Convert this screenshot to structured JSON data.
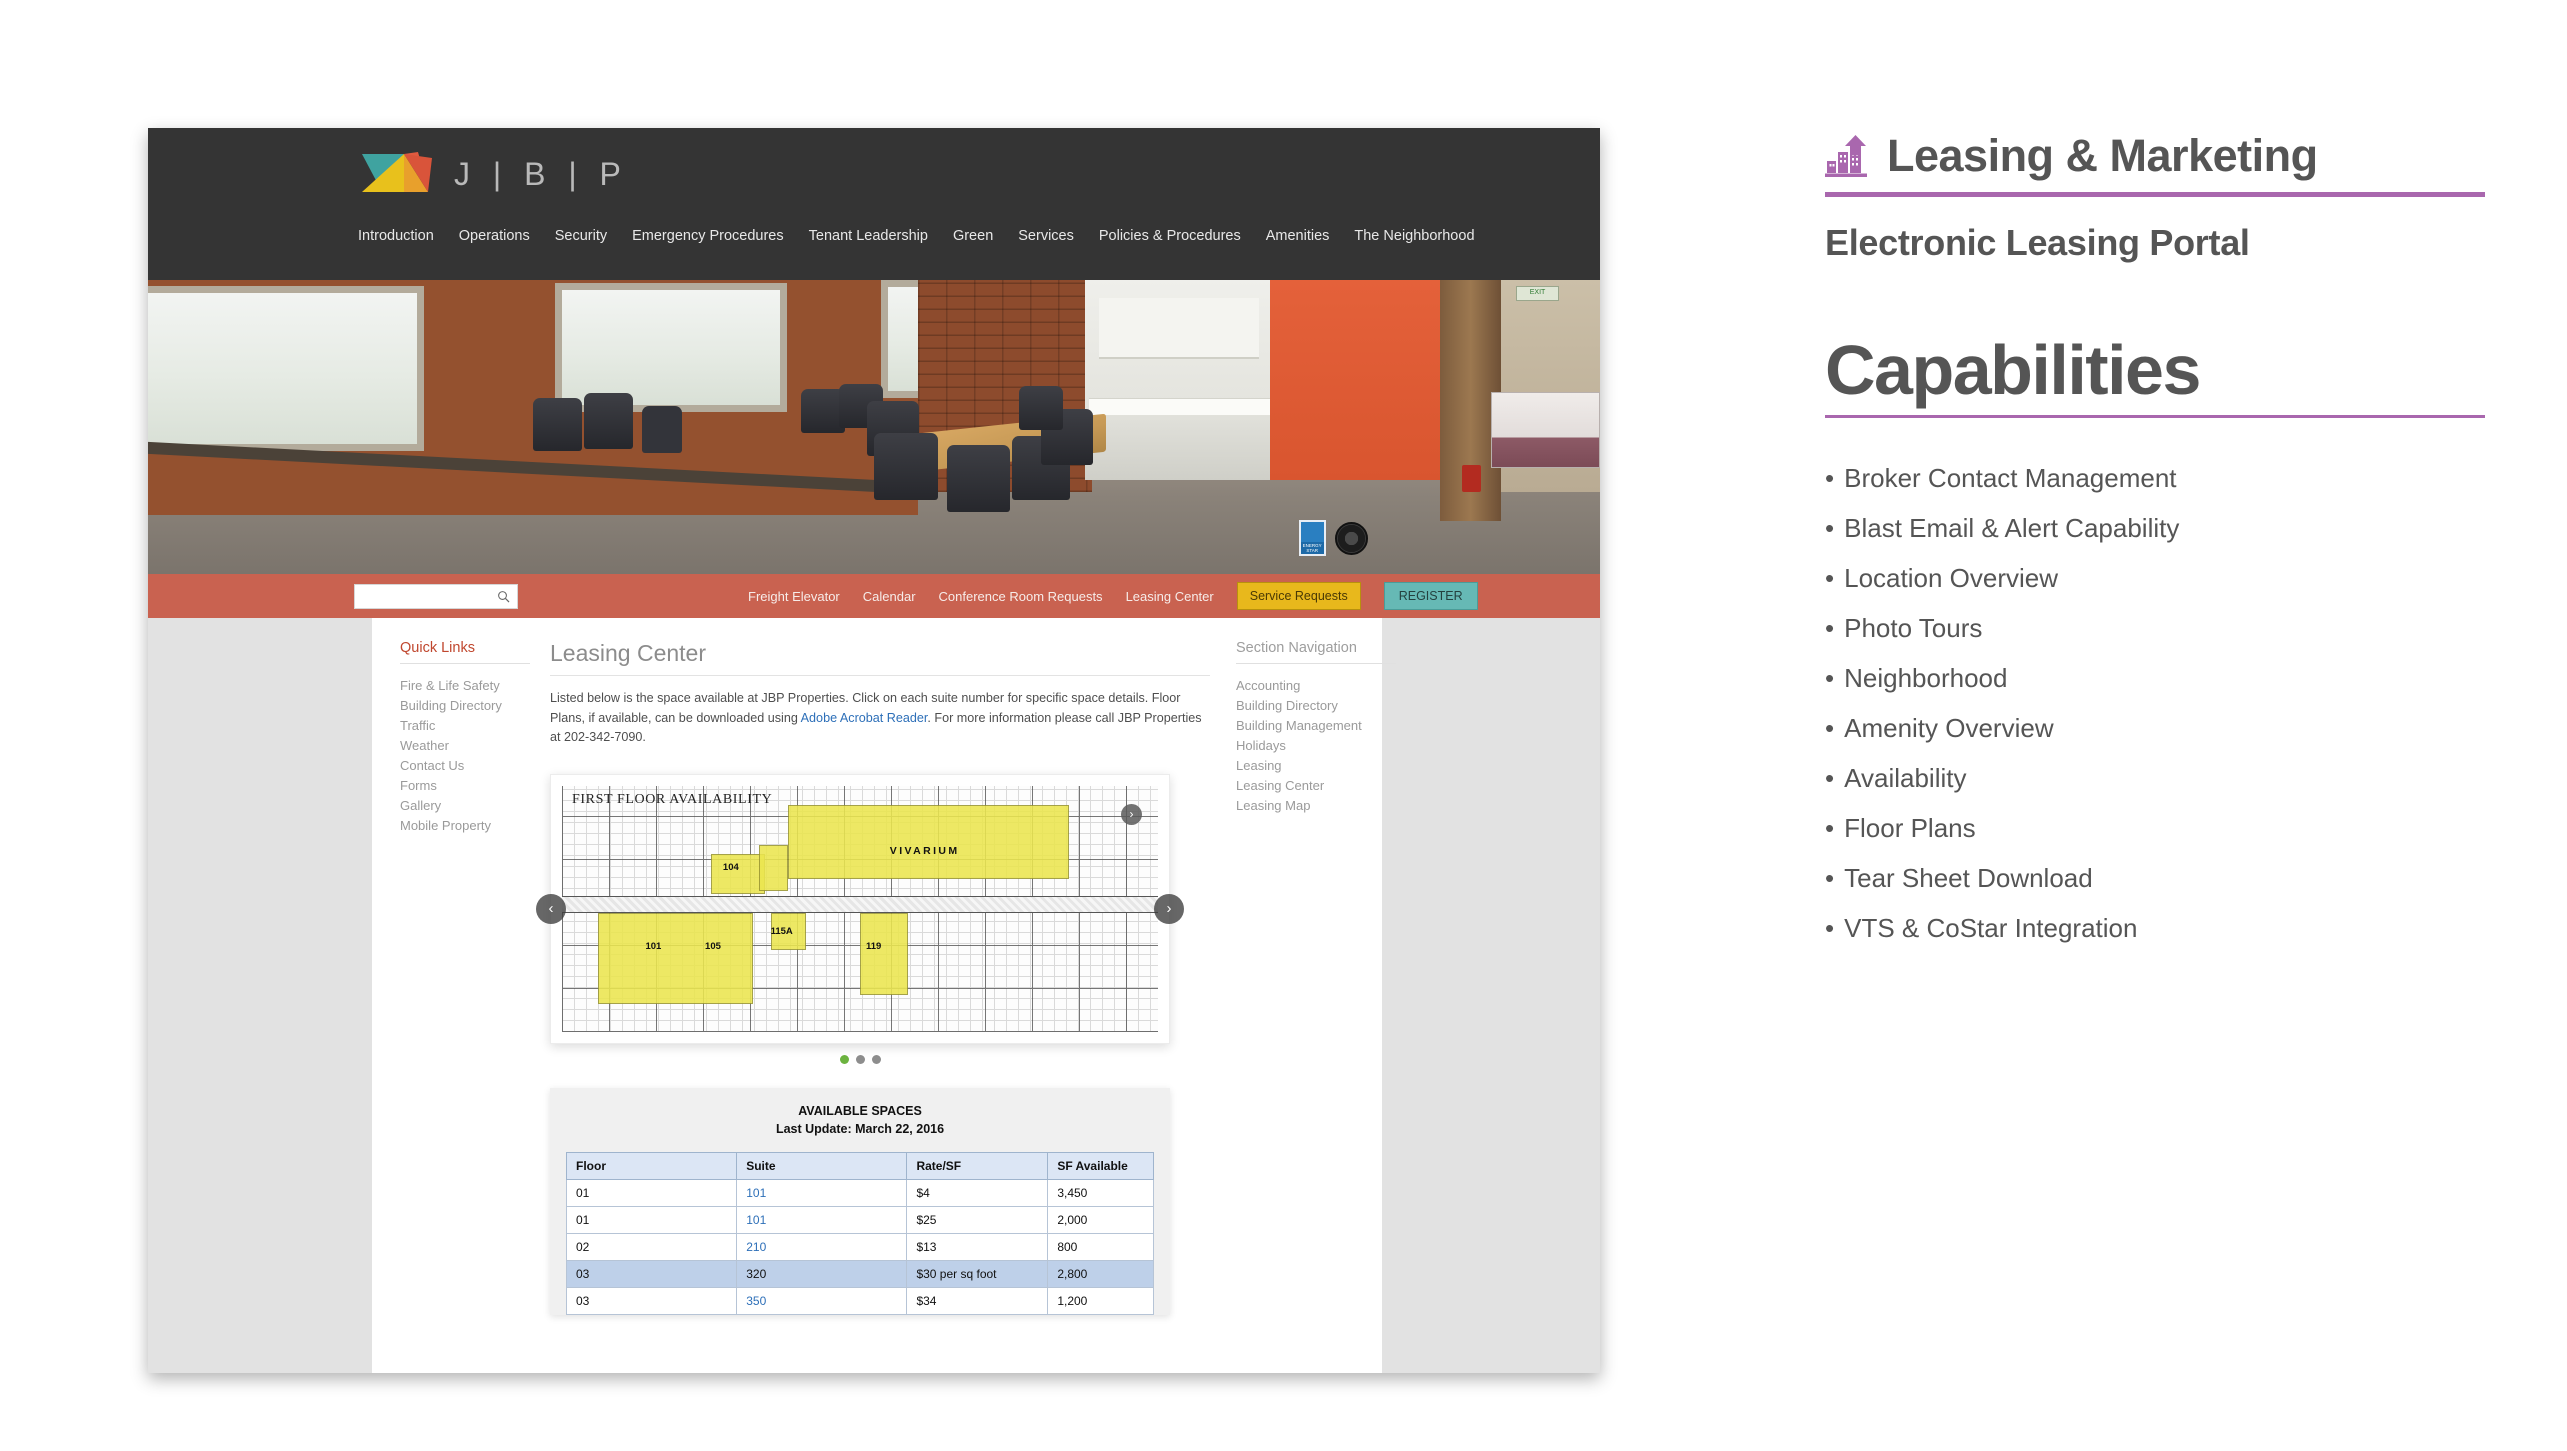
{
  "slide": {
    "header_title": "Leasing & Marketing",
    "header_icon": "buildings-growth-icon",
    "subtitle": "Electronic Leasing Portal",
    "capabilities_title": "Capabilities",
    "accent_color": "#a967ae",
    "text_color": "#555555",
    "capabilities": [
      "Broker Contact Management",
      "Blast Email & Alert Capability",
      "Location Overview",
      "Photo Tours",
      "Neighborhood",
      "Amenity Overview",
      "Availability",
      "Floor Plans",
      "Tear Sheet Download",
      "VTS & CoStar Integration"
    ],
    "bullet_char": "•"
  },
  "site": {
    "logo_text": "J | B | P",
    "logo_colors": [
      "#3fa3a0",
      "#e8c11c",
      "#e05a3f"
    ],
    "header_bg": "#343434",
    "utility_bg": "#c96250",
    "nav": [
      "Introduction",
      "Operations",
      "Security",
      "Emergency Procedures",
      "Tenant Leadership",
      "Green",
      "Services",
      "Policies & Procedures",
      "Amenities",
      "The Neighborhood"
    ],
    "hero": {
      "exit_sign": "EXIT",
      "badge_energy_star": "ENERGY STAR"
    },
    "utility": {
      "search_value": "",
      "search_placeholder": "",
      "links": [
        "Freight Elevator",
        "Calendar",
        "Conference Room Requests",
        "Leasing Center"
      ],
      "service_requests_label": "Service Requests",
      "register_label": "REGISTER",
      "service_color": "#e8b81c",
      "register_color": "#66b9b5"
    },
    "quick_links": {
      "title": "Quick Links",
      "items": [
        "Fire & Life Safety",
        "Building Directory",
        "Traffic",
        "Weather",
        "Contact Us",
        "Forms",
        "Gallery",
        "Mobile Property"
      ]
    },
    "section_nav": {
      "title": "Section Navigation",
      "items": [
        "Accounting",
        "Building Directory",
        "Building Management",
        "Holidays",
        "Leasing",
        "Leasing Center",
        "Leasing Map"
      ]
    },
    "main": {
      "heading": "Leasing Center",
      "intro_part1": "Listed below is the space available at JBP Properties. Click on each suite number for specific space details. Floor Plans, if available, can be downloaded using ",
      "intro_link": "Adobe Acrobat Reader",
      "intro_part2": ". For more information please call JBP Properties at 202-342-7090."
    },
    "carousel": {
      "floorplan_title": "FIRST FLOOR AVAILABILITY",
      "vivarium_label": "VIVARIUM",
      "suite_labels": [
        "104",
        "101",
        "105",
        "115A",
        "119"
      ],
      "prev_label": "‹",
      "next_label": "›",
      "slide_count": 3,
      "active_slide": 1
    },
    "availability": {
      "title": "AVAILABLE SPACES",
      "last_update": "Last Update: March 22, 2016",
      "columns": [
        "Floor",
        "Suite",
        "Rate/SF",
        "SF Available"
      ],
      "rows": [
        {
          "floor": "01",
          "suite": "101",
          "suite_link": true,
          "rate": "$4",
          "sf": "3,450",
          "highlight": false
        },
        {
          "floor": "01",
          "suite": "101",
          "suite_link": true,
          "rate": "$25",
          "sf": "2,000",
          "highlight": false
        },
        {
          "floor": "02",
          "suite": "210",
          "suite_link": true,
          "rate": "$13",
          "sf": "800",
          "highlight": false
        },
        {
          "floor": "03",
          "suite": "320",
          "suite_link": false,
          "rate": "$30 per sq foot",
          "sf": "2,800",
          "highlight": true
        },
        {
          "floor": "03",
          "suite": "350",
          "suite_link": true,
          "rate": "$34",
          "sf": "1,200",
          "highlight": false
        }
      ]
    }
  }
}
